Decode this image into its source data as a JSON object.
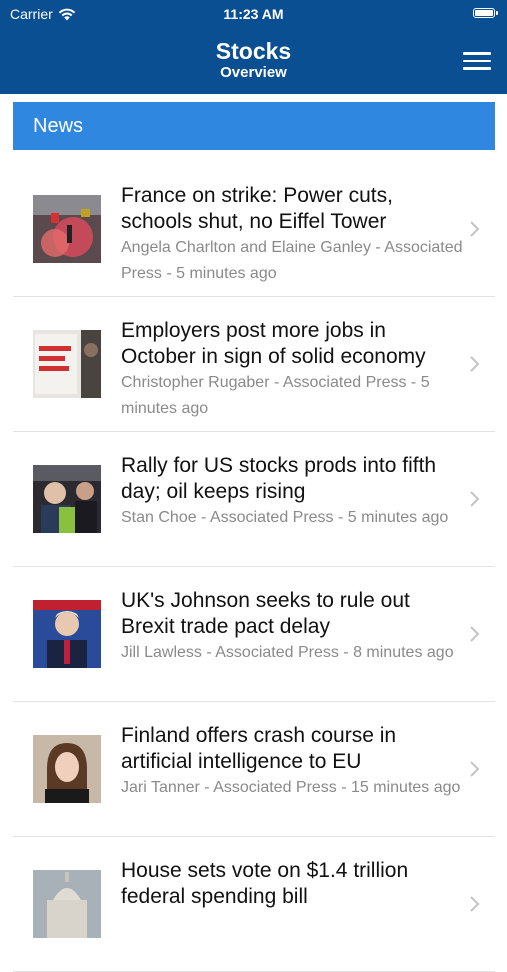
{
  "status_bar": {
    "carrier": "Carrier",
    "time": "11:23 AM"
  },
  "header": {
    "title": "Stocks",
    "subtitle": "Overview"
  },
  "section": {
    "label": "News"
  },
  "news": [
    {
      "headline": "France on strike: Power cuts, schools shut, no Eiffel Tower",
      "byline": "Angela Charlton and Elaine Ganley - Associated Press - 5 minutes ago",
      "thumb": "protest-photo"
    },
    {
      "headline": "Employers post more jobs in October in sign of solid economy",
      "byline": "Christopher Rugaber - Associated Press - 5 minutes ago",
      "thumb": "hiring-sign-photo"
    },
    {
      "headline": "Rally for US stocks prods into fifth day; oil keeps rising",
      "byline": "Stan Choe - Associated Press - 5 minutes ago",
      "thumb": "stock-traders-photo"
    },
    {
      "headline": "UK's Johnson seeks to rule out Brexit trade pact delay",
      "byline": "Jill Lawless - Associated Press - 8 minutes ago",
      "thumb": "johnson-photo"
    },
    {
      "headline": "Finland offers crash course in artificial intelligence to EU",
      "byline": "Jari Tanner - Associated Press - 15 minutes ago",
      "thumb": "woman-portrait-photo"
    },
    {
      "headline": "House sets vote on $1.4 trillion federal spending bill",
      "byline": "",
      "thumb": "capitol-photo"
    }
  ],
  "colors": {
    "header": "#0a4f92",
    "section_bar": "#2f87df",
    "byline": "#8a8a8a"
  }
}
